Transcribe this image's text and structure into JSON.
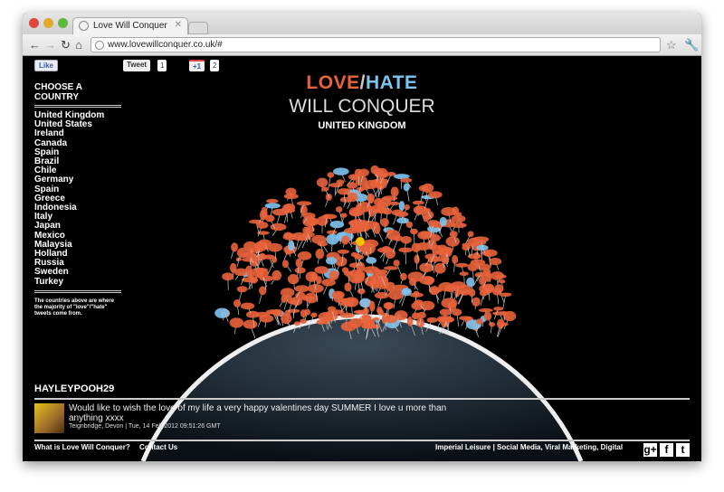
{
  "browser": {
    "tab_title": "Love Will Conquer",
    "url": "www.lovewillconquer.co.uk/#"
  },
  "social": {
    "like": "Like",
    "tweet": "Tweet",
    "tweet_count": "1",
    "plusone": "+1",
    "plusone_count": "2"
  },
  "header": {
    "love": "LOVE",
    "slash": "/",
    "hate": "HATE",
    "subtitle": "WILL CONQUER",
    "country": "UNITED KINGDOM"
  },
  "sidebar": {
    "heading": "CHOOSE A COUNTRY",
    "countries": [
      "United Kingdom",
      "United States",
      "Ireland",
      "Canada",
      "Spain",
      "Brazil",
      "Chile",
      "Germany",
      "Spain",
      "Greece",
      "Indonesia",
      "Italy",
      "Japan",
      "Mexico",
      "Malaysia",
      "Holland",
      "Russia",
      "Sweden",
      "Turkey"
    ],
    "note": "The countries above are where the majority of \"love\"/\"hate\" tweets come from."
  },
  "tweet": {
    "user": "HAYLEYPOOH29",
    "text": "Would like to wish the love of my life a very happy valentines day SUMMER I love u more than anything xxxx",
    "meta": "Teignbridge, Devon | Tue, 14 Feb 2012 09:51:26 GMT"
  },
  "footer": {
    "about": "What is Love Will Conquer?",
    "contact": "Contact Us",
    "credit": "Imperial Leisure | Social Media, Viral Marketing, Digital",
    "gplus": "g+",
    "facebook": "f",
    "twitter": "t"
  },
  "colors": {
    "love": "#e8623a",
    "hate": "#7ec3ee"
  }
}
